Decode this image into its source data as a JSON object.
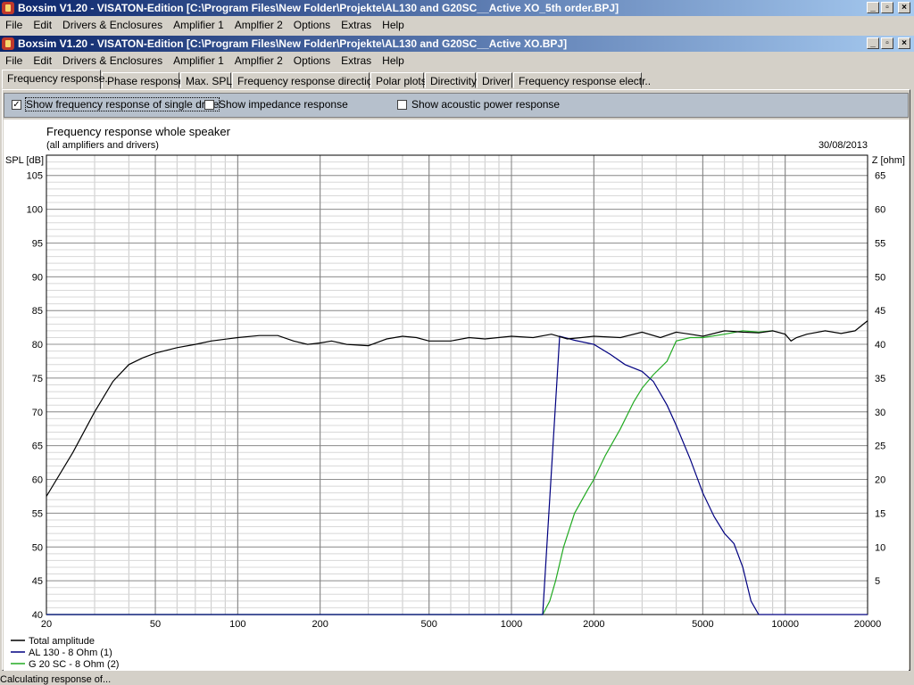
{
  "outer_window": {
    "title": "Boxsim V1.20 - VISATON-Edition [C:\\Program Files\\New Folder\\Projekte\\AL130 and G20SC__Active XO_5th order.BPJ]",
    "menu": [
      "File",
      "Edit",
      "Drivers & Enclosures",
      "Amplifier 1",
      "Amplfier 2",
      "Options",
      "Extras",
      "Help"
    ]
  },
  "inner_window": {
    "title": "Boxsim V1.20 - VISATON-Edition [C:\\Program Files\\New Folder\\Projekte\\AL130 and G20SC__Active XO.BPJ]",
    "menu": [
      "File",
      "Edit",
      "Drivers & Enclosures",
      "Amplifier 1",
      "Amplfier 2",
      "Options",
      "Extras",
      "Help"
    ]
  },
  "window_buttons": {
    "minimize": "_",
    "restore": "▫",
    "close": "×"
  },
  "tabs": [
    "Frequency response.",
    "Phase response",
    "Max. SPL",
    "Frequency response directions",
    "Polar plots",
    "Directivity",
    "Driver",
    "Frequency response electr.."
  ],
  "active_tab": 0,
  "options": [
    {
      "label": "Show frequency response of single drive",
      "checked": true
    },
    {
      "label": "Show impedance response",
      "checked": false
    },
    {
      "label": "Show acoustic power response",
      "checked": false
    }
  ],
  "status": "Calculating response of...",
  "chart_data": {
    "type": "line",
    "title": "Frequency response whole speaker",
    "subtitle": "(all amplifiers and drivers)",
    "date": "30/08/2013",
    "ylabel": "SPL [dB]",
    "y2label": "Z [ohm]",
    "xscale": "log",
    "xlim": [
      20,
      20000
    ],
    "ylim": [
      40,
      108
    ],
    "y2lim": [
      0,
      68
    ],
    "xticks": [
      20,
      50,
      100,
      200,
      500,
      1000,
      2000,
      5000,
      10000,
      20000
    ],
    "yticks": [
      40,
      45,
      50,
      55,
      60,
      65,
      70,
      75,
      80,
      85,
      90,
      95,
      100,
      105
    ],
    "y2ticks": [
      5,
      10,
      15,
      20,
      25,
      30,
      35,
      40,
      45,
      50,
      55,
      60,
      65
    ],
    "grid": true,
    "legend_position": "bottom-left",
    "series": [
      {
        "name": "Total amplitude",
        "color": "#000000",
        "x": [
          20,
          25,
          30,
          35,
          40,
          45,
          50,
          60,
          70,
          80,
          100,
          120,
          140,
          160,
          180,
          200,
          220,
          250,
          300,
          350,
          400,
          450,
          500,
          600,
          700,
          800,
          1000,
          1200,
          1400,
          1600,
          1800,
          2000,
          2500,
          3000,
          3500,
          4000,
          4500,
          5000,
          6000,
          7000,
          8000,
          9000,
          10000,
          10500,
          11000,
          12000,
          14000,
          16000,
          18000,
          20000
        ],
        "y": [
          57.5,
          64,
          70,
          74.5,
          77,
          78,
          78.7,
          79.5,
          80,
          80.5,
          81,
          81.3,
          81.3,
          80.5,
          80,
          80.2,
          80.5,
          80,
          79.8,
          80.8,
          81.2,
          81,
          80.5,
          80.5,
          81,
          80.8,
          81.2,
          81,
          81.5,
          80.8,
          81,
          81.2,
          81,
          81.8,
          81,
          81.8,
          81.5,
          81.2,
          82,
          81.8,
          81.7,
          82,
          81.5,
          80.5,
          81,
          81.5,
          82,
          81.6,
          82,
          83.5
        ]
      },
      {
        "name": "AL 130 - 8 Ohm (1)",
        "color": "#000080",
        "x": [
          20,
          50,
          100,
          200,
          500,
          1000,
          1300,
          1500,
          1700,
          2000,
          2300,
          2600,
          3000,
          3300,
          3700,
          4000,
          4500,
          5000,
          5500,
          6000,
          6500,
          7000,
          7500,
          8000,
          20000
        ],
        "y": [
          40,
          40,
          40,
          40,
          40,
          40,
          40,
          81.2,
          80.6,
          80,
          78.5,
          77,
          76,
          74.5,
          71,
          68,
          63,
          58,
          54.5,
          52,
          50.5,
          47,
          42,
          40,
          40
        ]
      },
      {
        "name": "G 20 SC - 8 Ohm (2)",
        "color": "#22aa22",
        "x": [
          20,
          100,
          500,
          1000,
          1300,
          1380,
          1450,
          1550,
          1700,
          1900,
          2000,
          2200,
          2500,
          2800,
          3000,
          3300,
          3700,
          4000,
          4500,
          5000,
          6000,
          7000,
          8000,
          9000
        ],
        "y": [
          40,
          40,
          40,
          40,
          40,
          42,
          45,
          50,
          55,
          58.5,
          60,
          63.5,
          67.5,
          71.5,
          73.5,
          75.5,
          77.5,
          80.5,
          81,
          81,
          81.5,
          82,
          81.8,
          82
        ]
      }
    ]
  }
}
